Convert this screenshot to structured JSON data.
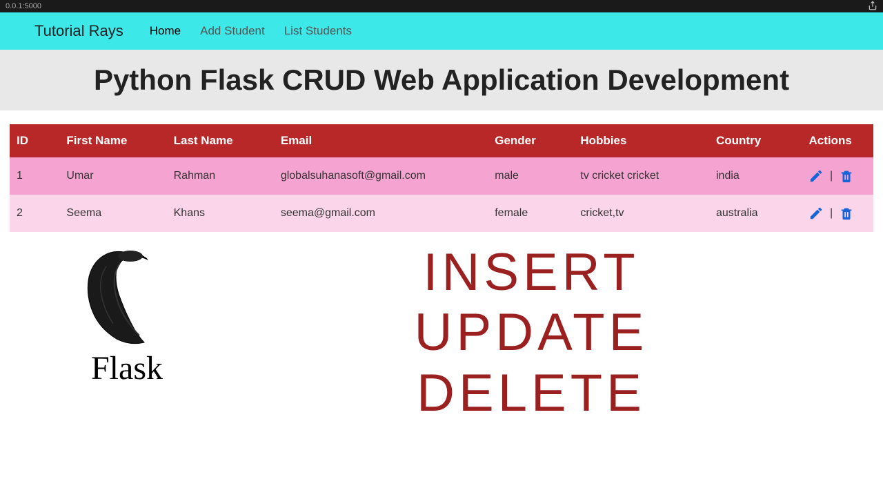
{
  "browser": {
    "url": "0.0.1:5000"
  },
  "navbar": {
    "brand": "Tutorial Rays",
    "links": {
      "home": "Home",
      "add": "Add Student",
      "list": "List Students"
    }
  },
  "page_title": "Python Flask CRUD Web Application Development",
  "table": {
    "headers": {
      "id": "ID",
      "first": "First Name",
      "last": "Last Name",
      "email": "Email",
      "gender": "Gender",
      "hobbies": "Hobbies",
      "country": "Country",
      "actions": "Actions"
    },
    "rows": [
      {
        "id": "1",
        "first": "Umar",
        "last": "Rahman",
        "email": "globalsuhanasoft@gmail.com",
        "gender": "male",
        "hobbies": "tv cricket cricket",
        "country": "india"
      },
      {
        "id": "2",
        "first": "Seema",
        "last": "Khans",
        "email": "seema@gmail.com",
        "gender": "female",
        "hobbies": "cricket,tv",
        "country": "australia"
      }
    ]
  },
  "action_separator": "|",
  "logo_text": "Flask",
  "crud_words": {
    "insert": "INSERT",
    "update": "UPDATE",
    "delete": "DELETE"
  }
}
